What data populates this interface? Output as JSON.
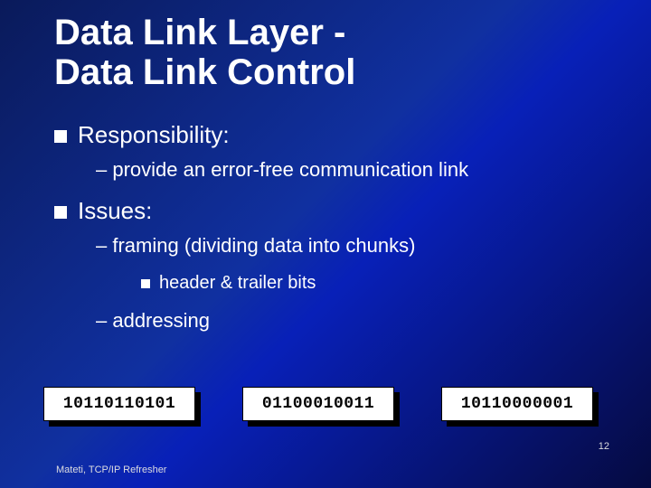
{
  "title": "Data Link Layer -\nData Link Control",
  "bullets": {
    "b1": {
      "label": "Responsibility:",
      "s1": "– provide an error-free communication link"
    },
    "b2": {
      "label": "Issues:",
      "s1": "– framing (dividing data into chunks)",
      "s1a": "header & trailer bits",
      "s2": "– addressing"
    }
  },
  "chunks": {
    "c1": "10110110101",
    "c2": "01100010011",
    "c3": "10110000001"
  },
  "footer": "Mateti, TCP/IP Refresher",
  "page": "12"
}
